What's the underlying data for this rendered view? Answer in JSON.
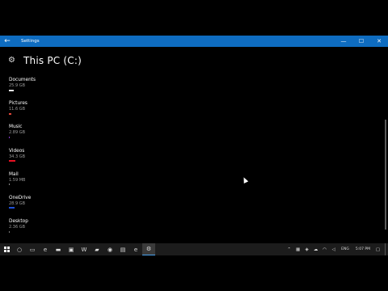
{
  "titlebar": {
    "back_glyph": "←",
    "title": "Settings",
    "minimize_glyph": "—",
    "maximize_glyph": "☐",
    "close_glyph": "✕",
    "accent_color": "#0e6cc0"
  },
  "header": {
    "icon": "gear-icon",
    "title": "This PC (C:)"
  },
  "storage_items": [
    {
      "name": "Documents",
      "size": "25.9 GB",
      "bar_color": "#e8e8e8",
      "bar_fraction": 0.6
    },
    {
      "name": "Pictures",
      "size": "11.6 GB",
      "bar_color": "#e0483a",
      "bar_fraction": 0.3
    },
    {
      "name": "Music",
      "size": "2.89 GB",
      "bar_color": "#8a3ad0",
      "bar_fraction": 0.12
    },
    {
      "name": "Videos",
      "size": "34.3 GB",
      "bar_color": "#e81123",
      "bar_fraction": 0.8
    },
    {
      "name": "Mail",
      "size": "1.59 MB",
      "bar_color": "#888888",
      "bar_fraction": 0.0
    },
    {
      "name": "OneDrive",
      "size": "28.9 GB",
      "bar_color": "#1e4fd8",
      "bar_fraction": 0.65
    },
    {
      "name": "Desktop",
      "size": "2.36 GB",
      "bar_color": "#7a7a7a",
      "bar_fraction": 0.1
    }
  ],
  "taskbar": {
    "start_icon": "windows-logo-icon",
    "search_glyph": "○",
    "task_view_glyph": "▭",
    "apps": [
      {
        "name": "edge-icon",
        "glyph": "e"
      },
      {
        "name": "file-explorer-icon",
        "glyph": "▬"
      },
      {
        "name": "store-icon",
        "glyph": "▣"
      },
      {
        "name": "word-icon",
        "glyph": "W"
      },
      {
        "name": "media-icon",
        "glyph": "▰"
      },
      {
        "name": "chrome-icon",
        "glyph": "◉"
      },
      {
        "name": "notes-icon",
        "glyph": "▤"
      },
      {
        "name": "ie-icon",
        "glyph": "e"
      },
      {
        "name": "settings-icon",
        "glyph": "⚙"
      }
    ],
    "tray": {
      "people_glyph": "⌃",
      "network_glyph": "▦",
      "shield_glyph": "◈",
      "cloud_glyph": "☁",
      "wifi_glyph": "◠",
      "volume_glyph": "◁",
      "language": "ENG",
      "time": "5:07 PM",
      "notification_glyph": "▢"
    }
  }
}
